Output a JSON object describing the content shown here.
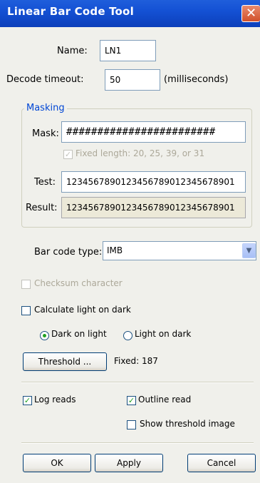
{
  "window": {
    "title": "Linear Bar Code Tool",
    "close_glyph": "✕"
  },
  "name": {
    "label": "Name:",
    "value": "LN1"
  },
  "decode_timeout": {
    "label": "Decode timeout:",
    "value": "50",
    "unit": "(milliseconds)"
  },
  "masking": {
    "title": "Masking",
    "mask_label": "Mask:",
    "mask_value": "########################",
    "fixed_length_label": "Fixed length: 20, 25, 39, or 31",
    "fixed_length_checked": true,
    "test_label": "Test:",
    "test_value": "1234567890123456789012345678901",
    "result_label": "Result:",
    "result_value": "1234567890123456789012345678901"
  },
  "bar_code_type": {
    "label": "Bar code type:",
    "value": "IMB"
  },
  "checksum": {
    "label": "Checksum character",
    "checked": false,
    "enabled": false
  },
  "calc_light_on_dark": {
    "label": "Calculate light on dark",
    "checked": false
  },
  "polarity": {
    "dark_on_light": "Dark on light",
    "light_on_dark": "Light on dark",
    "selected": "dark_on_light"
  },
  "threshold": {
    "button": "Threshold ...",
    "status": "Fixed: 187"
  },
  "options": {
    "log_reads": {
      "label": "Log reads",
      "checked": true
    },
    "outline_read": {
      "label": "Outline read",
      "checked": true
    },
    "show_threshold_image": {
      "label": "Show threshold image",
      "checked": false
    }
  },
  "buttons": {
    "ok": "OK",
    "apply": "Apply",
    "cancel": "Cancel"
  },
  "icons": {
    "check": "✓",
    "dropdown": "▼"
  },
  "colors": {
    "accent": "#0046d5",
    "titlebar": "#1451d4",
    "check": "#21a121"
  }
}
